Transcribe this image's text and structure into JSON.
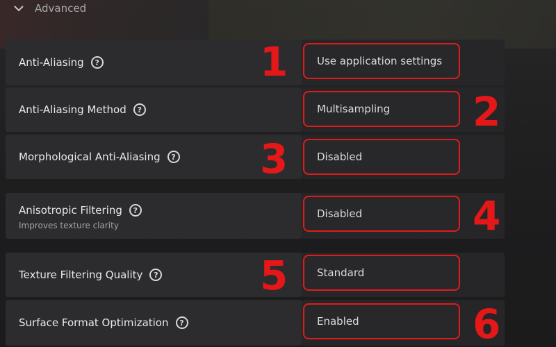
{
  "section": {
    "title": "Advanced",
    "toggle_icon": "chevron-down-icon"
  },
  "settings": [
    {
      "label": "Anti-Aliasing",
      "sublabel": "",
      "value": "Use application settings",
      "marker": "1"
    },
    {
      "label": "Anti-Aliasing Method",
      "sublabel": "",
      "value": "Multisampling",
      "marker": "2"
    },
    {
      "label": "Morphological Anti-Aliasing",
      "sublabel": "",
      "value": "Disabled",
      "marker": "3"
    },
    {
      "label": "Anisotropic Filtering",
      "sublabel": "Improves texture clarity",
      "value": "Disabled",
      "marker": "4"
    },
    {
      "label": "Texture Filtering Quality",
      "sublabel": "",
      "value": "Standard",
      "marker": "5"
    },
    {
      "label": "Surface Format Optimization",
      "sublabel": "",
      "value": "Enabled",
      "marker": "6"
    }
  ],
  "help_icon": {
    "glyph": "?",
    "name": "help-icon"
  },
  "colors": {
    "annotation_red": "#e01b1b",
    "row_background": "#2c2c2e",
    "text_primary": "#e9e9ea",
    "text_secondary": "#a3a3a6"
  }
}
